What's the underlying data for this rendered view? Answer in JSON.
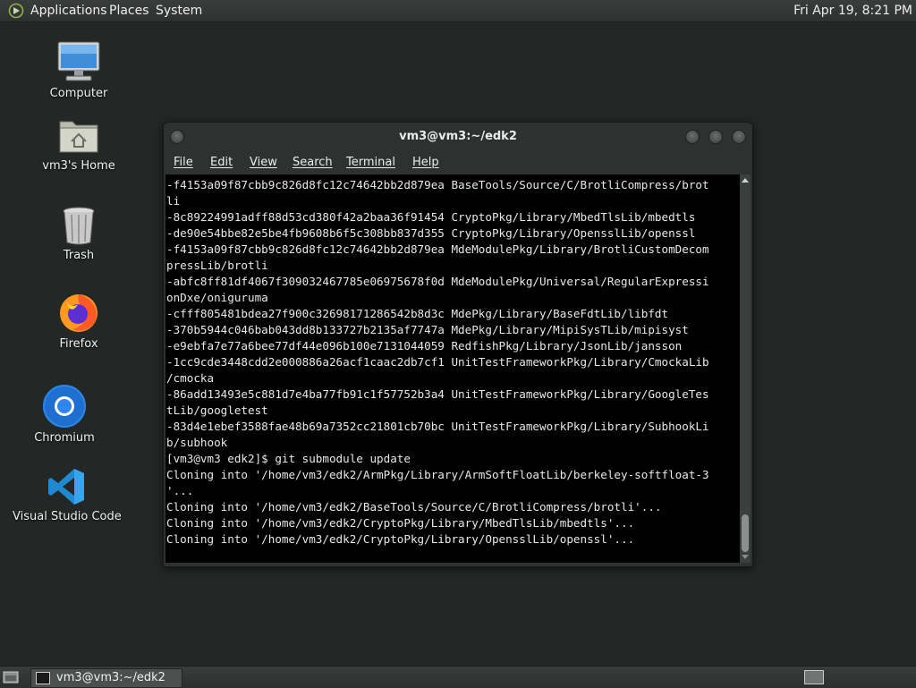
{
  "top_panel": {
    "menu": [
      "Applications",
      "Places",
      "System"
    ],
    "clock": "Fri Apr 19,  8:21 PM"
  },
  "desktop_icons": [
    {
      "label": "Computer",
      "icon": "computer-icon"
    },
    {
      "label": "vm3's Home",
      "icon": "home-folder-icon"
    },
    {
      "label": "Trash",
      "icon": "trash-icon"
    },
    {
      "label": "Firefox",
      "icon": "firefox-icon"
    },
    {
      "label": "Chromium",
      "icon": "chromium-icon"
    },
    {
      "label": "Visual Studio Code",
      "icon": "vscode-icon"
    }
  ],
  "terminal": {
    "title": "vm3@vm3:~/edk2",
    "menu": [
      "File",
      "Edit",
      "View",
      "Search",
      "Terminal",
      "Help"
    ],
    "lines": [
      "-f4153a09f87cbb9c826d8fc12c74642bb2d879ea BaseTools/Source/C/BrotliCompress/brot",
      "li",
      "-8c89224991adff88d53cd380f42a2baa36f91454 CryptoPkg/Library/MbedTlsLib/mbedtls",
      "-de90e54bbe82e5be4fb9608b6f5c308bb837d355 CryptoPkg/Library/OpensslLib/openssl",
      "-f4153a09f87cbb9c826d8fc12c74642bb2d879ea MdeModulePkg/Library/BrotliCustomDecom",
      "pressLib/brotli",
      "-abfc8ff81df4067f309032467785e06975678f0d MdeModulePkg/Universal/RegularExpressi",
      "onDxe/oniguruma",
      "-cfff805481bdea27f900c32698171286542b8d3c MdePkg/Library/BaseFdtLib/libfdt",
      "-370b5944c046bab043dd8b133727b2135af7747a MdePkg/Library/MipiSysTLib/mipisyst",
      "-e9ebfa7e77a6bee77df44e096b100e7131044059 RedfishPkg/Library/JsonLib/jansson",
      "-1cc9cde3448cdd2e000886a26acf1caac2db7cf1 UnitTestFrameworkPkg/Library/CmockaLib",
      "/cmocka",
      "-86add13493e5c881d7e4ba77fb91c1f57752b3a4 UnitTestFrameworkPkg/Library/GoogleTes",
      "tLib/googletest",
      "-83d4e1ebef3588fae48b69a7352cc21801cb70bc UnitTestFrameworkPkg/Library/SubhookLi",
      "b/subhook",
      "[vm3@vm3 edk2]$ git submodule update",
      "Cloning into '/home/vm3/edk2/ArmPkg/Library/ArmSoftFloatLib/berkeley-softfloat-3",
      "'...",
      "Cloning into '/home/vm3/edk2/BaseTools/Source/C/BrotliCompress/brotli'...",
      "Cloning into '/home/vm3/edk2/CryptoPkg/Library/MbedTlsLib/mbedtls'...",
      "Cloning into '/home/vm3/edk2/CryptoPkg/Library/OpensslLib/openssl'..."
    ]
  },
  "taskbar": {
    "window_button": "vm3@vm3:~/edk2"
  }
}
